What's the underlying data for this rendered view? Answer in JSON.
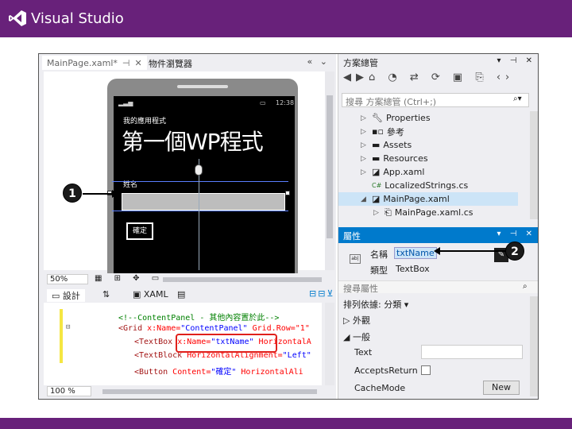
{
  "header": {
    "product_title": "Visual Studio"
  },
  "designer": {
    "doc_tab": "MainPage.xaml*",
    "doc_tab_pin": "⊣",
    "doc_tab_close": "✕",
    "second_tab": "物件瀏覽器",
    "tab_chevrons": "«  ⌄",
    "phone": {
      "time": "12:38",
      "app_title": "我的應用程式",
      "page_title": "第一個WP程式",
      "name_label": "姓名",
      "button_label": "確定"
    },
    "zoom": "50%",
    "view_tabs": {
      "design": "設計",
      "swap": "⇅",
      "xaml": "XAML"
    },
    "code_lines": [
      {
        "comment": "<!--ContentPanel - 其他內容置於此-->"
      },
      {
        "tag": "<Grid ",
        "attr": "x:Name=",
        "val": "\"ContentPanel\"",
        "rest": " Grid.Row=\"1\""
      },
      {
        "tag": "<TextBox ",
        "attr": "x:Name=",
        "val": "\"txtName\"",
        "rest": " HorizontalA"
      },
      {
        "tag": "<TextBlock ",
        "attr": "HorizontalAlignment=",
        "val": "\"Left\"",
        "rest": ""
      },
      {
        "tag": "<Button ",
        "attr": "Content=",
        "val": "\"確定\"",
        "rest": " HorizontalAli"
      }
    ],
    "code_zoom": "100 %"
  },
  "callouts": {
    "one": "1",
    "two": "2"
  },
  "solution_explorer": {
    "title": "方案總管",
    "title_icons": "▾ ⊣ ✕",
    "search_placeholder": "搜尋 方案總管 (Ctrl+;)",
    "items": [
      {
        "label": "Properties",
        "icon": "wrench-icon"
      },
      {
        "label": "參考",
        "icon": "references-icon"
      },
      {
        "label": "Assets",
        "icon": "folder-icon"
      },
      {
        "label": "Resources",
        "icon": "folder-icon"
      },
      {
        "label": "App.xaml",
        "icon": "xaml-file-icon"
      },
      {
        "label": "LocalizedStrings.cs",
        "icon": "csharp-file-icon"
      },
      {
        "label": "MainPage.xaml",
        "icon": "xaml-file-icon"
      },
      {
        "label": "MainPage.xaml.cs",
        "icon": "csharp-file-icon"
      }
    ]
  },
  "properties": {
    "title": "屬性",
    "title_icons": "▾ ⊣ ✕",
    "name_label": "名稱",
    "name_value": "txtName",
    "type_label": "類型",
    "type_value": "TextBox",
    "search_placeholder": "搜尋屬性",
    "arrange_by": "排列依據: 分類 ▾",
    "cat_appearance": "外觀",
    "cat_common": "一般",
    "prop_text": "Text",
    "prop_accepts_return": "AcceptsReturn",
    "prop_cache_mode": "CacheMode",
    "new_button": "New"
  },
  "colors": {
    "brand": "#68217a",
    "accent": "#007acc",
    "callout_box": "#e0201b"
  }
}
